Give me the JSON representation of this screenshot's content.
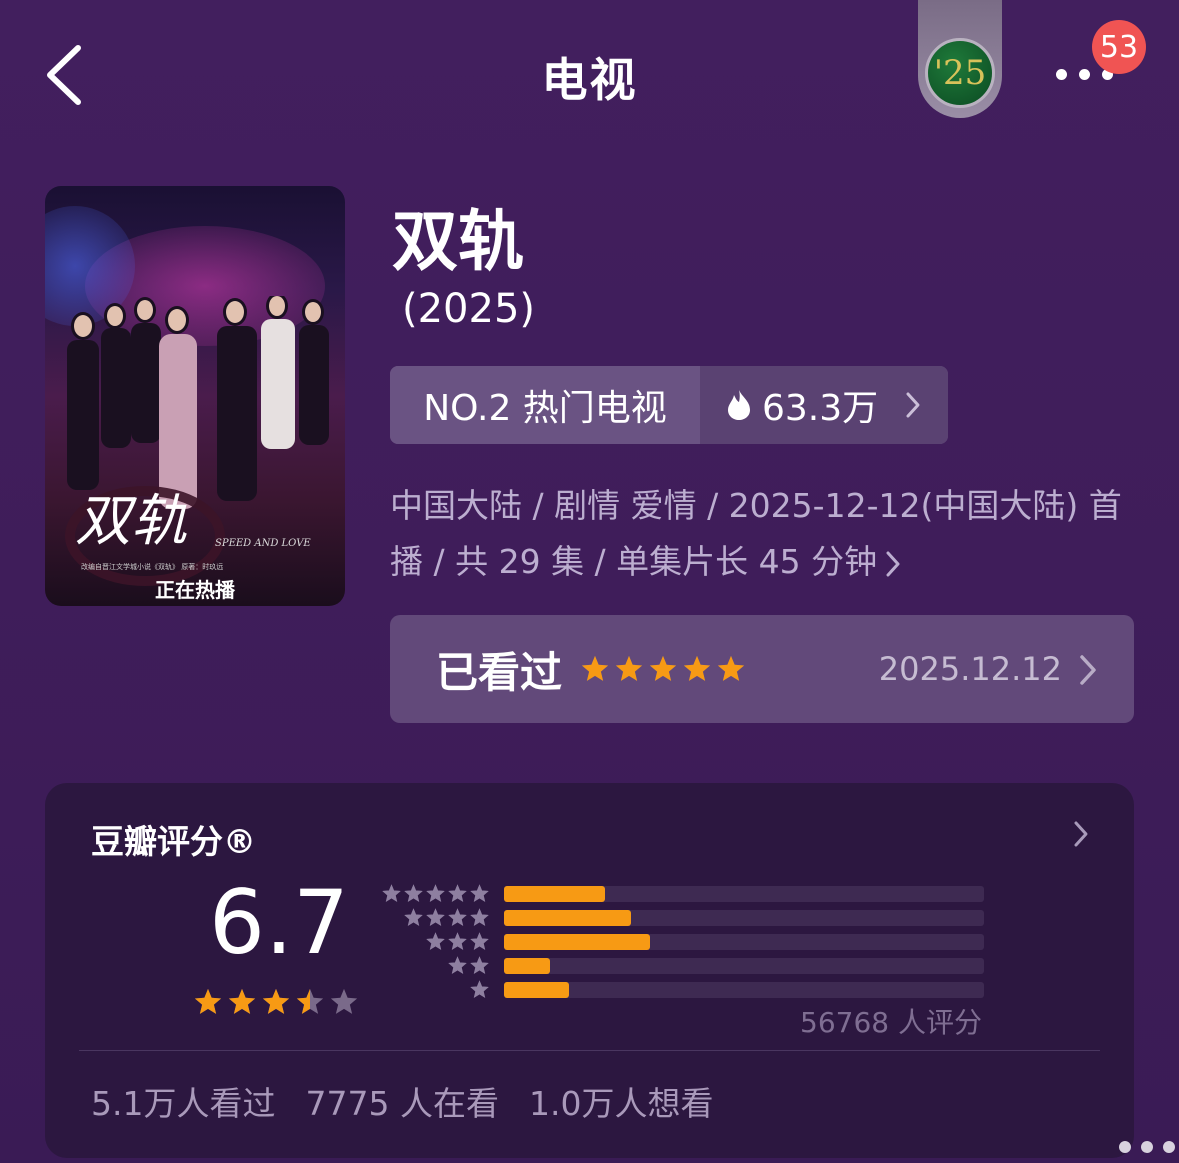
{
  "header": {
    "title": "电视",
    "badge_text": "'25",
    "notification_count": "53"
  },
  "poster": {
    "title_art": "双轨",
    "subtitle": "SPEED AND LOVE",
    "credit": "改编自晋江文学城小说《双轨》 原著：时玖远",
    "status": "正在热播"
  },
  "show": {
    "name": "双轨",
    "year": "(2025)",
    "rank_label": "NO.2 热门电视",
    "heat": "63.3万",
    "meta_line1": "中国大陆 / 剧情 爱情 / 2025-12-12(中国大陆) 首",
    "meta_line2": "播 / 共 29 集 / 单集片长 45 分钟"
  },
  "watched": {
    "label": "已看过",
    "rating_stars": 5,
    "date": "2025.12.12"
  },
  "rating": {
    "title": "豆瓣评分®",
    "score": "6.7",
    "score_stars": 3.5,
    "distribution": [
      {
        "stars": 5,
        "fraction": 0.21
      },
      {
        "stars": 4,
        "fraction": 0.265
      },
      {
        "stars": 3,
        "fraction": 0.305
      },
      {
        "stars": 2,
        "fraction": 0.095
      },
      {
        "stars": 1,
        "fraction": 0.135
      }
    ],
    "count_text": "56768 人评分",
    "stats": {
      "watched": "5.1万人看过",
      "watching": "7775 人在看",
      "want": "1.0万人想看"
    }
  },
  "colors": {
    "accent_orange": "#f79a14",
    "background": "#3f1d5a",
    "star_gray": "#7a6a8a",
    "notification": "#f05453"
  }
}
